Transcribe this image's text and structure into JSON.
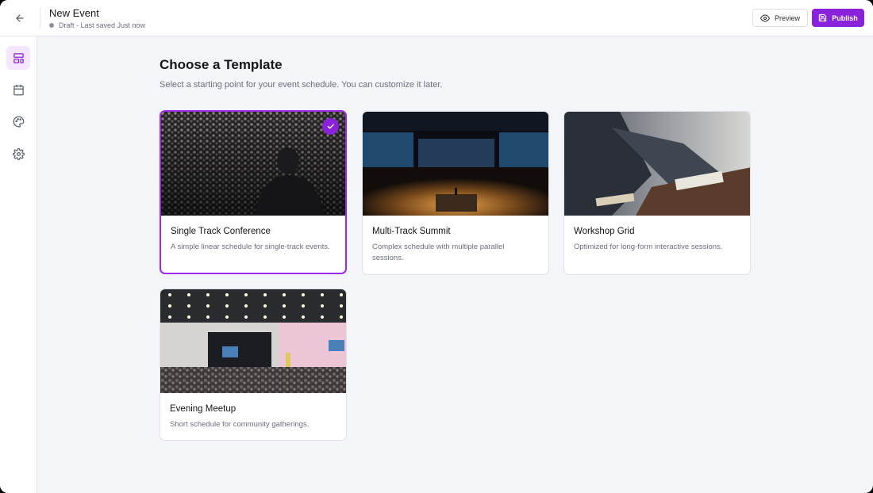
{
  "header": {
    "title": "New Event",
    "status": "Draft - Last saved Just now",
    "preview_label": "Preview",
    "publish_label": "Publish"
  },
  "sidebar": {
    "items": [
      {
        "icon": "layout-template-icon",
        "active": true
      },
      {
        "icon": "calendar-icon",
        "active": false
      },
      {
        "icon": "palette-icon",
        "active": false
      },
      {
        "icon": "gear-icon",
        "active": false
      }
    ]
  },
  "main": {
    "title": "Choose a Template",
    "subtitle": "Select a starting point for your event schedule. You can customize it later.",
    "templates": [
      {
        "name": "Single Track Conference",
        "description": "A simple linear schedule for single-track events.",
        "selected": true
      },
      {
        "name": "Multi-Track Summit",
        "description": "Complex schedule with multiple parallel sessions.",
        "selected": false
      },
      {
        "name": "Workshop Grid",
        "description": "Optimized for long-form interactive sessions.",
        "selected": false
      },
      {
        "name": "Evening Meetup",
        "description": "Short schedule for community gatherings.",
        "selected": false
      }
    ]
  },
  "colors": {
    "accent": "#8a21db",
    "active_bg": "#f3e6fd",
    "page_bg": "#f4f5f9"
  }
}
